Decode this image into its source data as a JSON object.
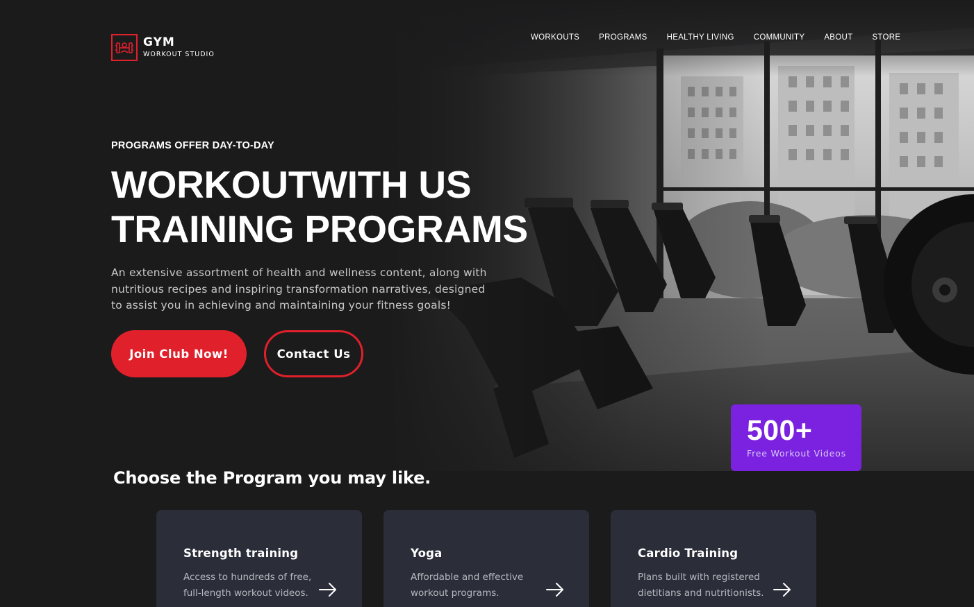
{
  "brand": {
    "title": "GYM",
    "subtitle": "WORKOUT STUDIO",
    "accent": "#e0202b"
  },
  "nav": [
    "WORKOUTS",
    "PROGRAMS",
    "HEALTHY LIVING",
    "COMMUNITY",
    "ABOUT",
    "STORE"
  ],
  "hero": {
    "eyebrow": "PROGRAMS OFFER DAY-TO-DAY",
    "headline_line1": "WORKOUTWITH US",
    "headline_line2": "TRAINING PROGRAMS",
    "lead": "An extensive assortment of health and wellness content, along with nutritious recipes and inspiring transformation narratives, designed to assist you in achieving and maintaining your fitness goals!",
    "primary_button": "Join Club Now!",
    "secondary_button": "Contact Us"
  },
  "stat": {
    "value": "500+",
    "label": "Free Workout Videos",
    "color": "#7a22e0"
  },
  "programs": {
    "title": "Choose the Program you may like.",
    "cards": [
      {
        "title": "Strength training",
        "desc": "Access to hundreds of free, full-length workout videos.",
        "icon": "arrow-right-icon"
      },
      {
        "title": "Yoga",
        "desc": "Affordable and effective workout programs.",
        "icon": "arrow-right-icon"
      },
      {
        "title": "Cardio Training",
        "desc": "Plans built with registered dietitians and nutritionists.",
        "icon": "arrow-right-icon"
      }
    ]
  }
}
